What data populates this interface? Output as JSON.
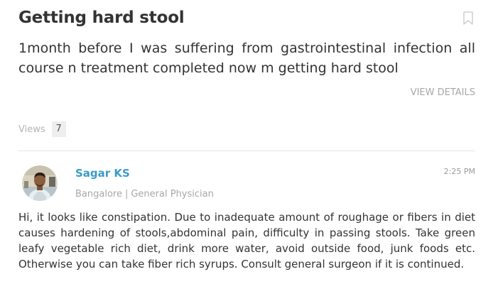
{
  "question": {
    "title": "Getting hard stool",
    "body": "1month before I was suffering from gastrointestinal infection all course n treatment completed now m getting hard stool",
    "view_details_label": "VIEW DETAILS",
    "views_label": "Views",
    "views_count": "7"
  },
  "answer": {
    "doctor_name": "Sagar KS",
    "location": "Bangalore",
    "separator": "|",
    "specialty": "General Physician",
    "time": "2:25 PM",
    "body": "Hi, it looks like constipation. Due to inadequate amount of roughage or fibers in diet causes hardening of stools,abdominal pain, difficulty in passing stools. Take green leafy vegetable rich diet, drink more water, avoid outside food, junk foods etc. Otherwise you can take fiber rich syrups. Consult general surgeon if it is continued."
  },
  "icons": {
    "bookmark": "bookmark-icon",
    "avatar": "doctor-avatar"
  },
  "colors": {
    "link": "#3a9bc9",
    "muted": "#a7a7a7",
    "text": "#333333"
  }
}
